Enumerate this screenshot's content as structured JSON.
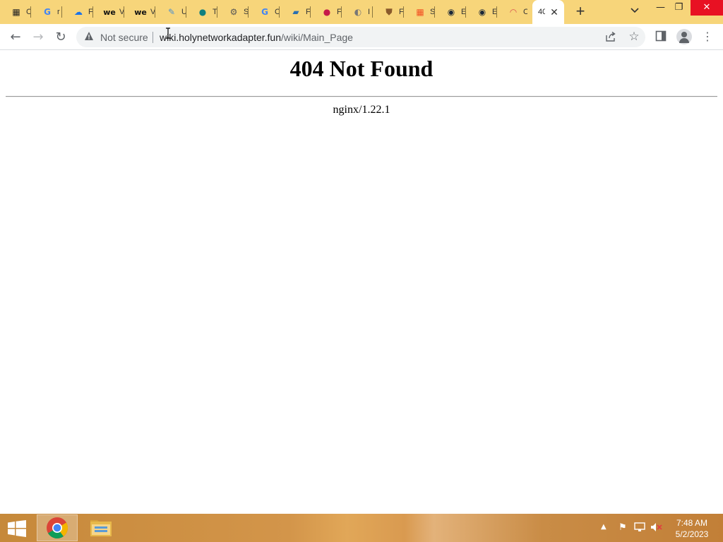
{
  "tabs": [
    {
      "icon": "apps-icon",
      "title": "C"
    },
    {
      "icon": "google-icon",
      "title": "r"
    },
    {
      "icon": "cloud-app-icon",
      "title": "F"
    },
    {
      "icon": "we-icon",
      "title": "V"
    },
    {
      "icon": "we-icon",
      "title": "V"
    },
    {
      "icon": "pen-icon",
      "title": "U"
    },
    {
      "icon": "globe-teal-icon",
      "title": "T"
    },
    {
      "icon": "gear-icon",
      "title": "S"
    },
    {
      "icon": "google-icon",
      "title": "C"
    },
    {
      "icon": "blue-app-icon",
      "title": "F"
    },
    {
      "icon": "raspberry-icon",
      "title": "F"
    },
    {
      "icon": "globe-icon",
      "title": "I"
    },
    {
      "icon": "shield-icon",
      "title": "F"
    },
    {
      "icon": "microsoft-icon",
      "title": "S"
    },
    {
      "icon": "steam-icon",
      "title": "E"
    },
    {
      "icon": "steam-icon",
      "title": "E"
    },
    {
      "icon": "rainbow-icon",
      "title": "C"
    }
  ],
  "active_tab": {
    "title": "40"
  },
  "toolbar": {
    "security_label": "Not secure",
    "url_host": "wiki.holynetworkadapter.fun",
    "url_path": "/wiki/Main_Page"
  },
  "page": {
    "heading": "404 Not Found",
    "server": "nginx/1.22.1"
  },
  "taskbar": {
    "time": "7:48 AM",
    "date": "5/2/2023"
  },
  "colors": {
    "tabstrip": "#f7d57a",
    "close_button": "#e81123"
  }
}
